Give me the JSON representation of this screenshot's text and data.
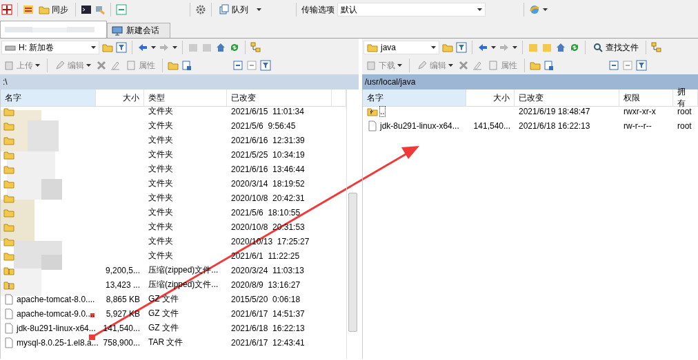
{
  "toolbar": {
    "sync": "同步",
    "queue": "队列",
    "transfer_label": "传输选项",
    "transfer_value": "默认"
  },
  "tabs": [
    {
      "kind": "blurred",
      "selected": true
    },
    {
      "kind": "new",
      "label": "新建会话",
      "selected": false
    }
  ],
  "left": {
    "drive": "H: 新加卷",
    "actions": [
      {
        "label": "上传",
        "disabled": true
      },
      {
        "label": "编辑",
        "disabled": true
      },
      {
        "label": "属性",
        "disabled": true
      }
    ],
    "path": ":\\",
    "columns": [
      "名字",
      "大小",
      "类型",
      "已改变"
    ],
    "rows": [
      {
        "kind": "folder",
        "type": "文件夹",
        "modified": "2021/6/15  11:01:34"
      },
      {
        "kind": "folder",
        "type": "文件夹",
        "modified": "2021/5/6  9:56:45"
      },
      {
        "kind": "folder",
        "type": "文件夹",
        "modified": "2021/6/16  12:31:39"
      },
      {
        "kind": "folder",
        "type": "文件夹",
        "modified": "2021/5/25  10:34:19"
      },
      {
        "kind": "folder",
        "type": "文件夹",
        "modified": "2021/6/16  13:46:44"
      },
      {
        "kind": "folder",
        "type": "文件夹",
        "modified": "2020/3/14  18:19:52"
      },
      {
        "kind": "folder",
        "type": "文件夹",
        "modified": "2020/10/8  20:42:31"
      },
      {
        "kind": "folder",
        "type": "文件夹",
        "modified": "2021/5/6  18:10:55"
      },
      {
        "kind": "folder",
        "type": "文件夹",
        "modified": "2020/10/8  20:31:53"
      },
      {
        "kind": "folder",
        "type": "文件夹",
        "modified": "2020/10/13  17:25:27"
      },
      {
        "kind": "folder",
        "type": "文件夹",
        "modified": "2021/6/1  11:22:25"
      },
      {
        "kind": "zip",
        "size": "9,200,5...",
        "type": "压缩(zipped)文件...",
        "modified": "2020/3/24  11:03:13"
      },
      {
        "kind": "zip",
        "size": "13,423 ...",
        "type": "压缩(zipped)文件...",
        "modified": "2020/8/9  13:16:27"
      },
      {
        "kind": "file",
        "name": "apache-tomcat-8.0....",
        "size": "8,865 KB",
        "type": "GZ 文件",
        "modified": "2015/5/20  0:06:18"
      },
      {
        "kind": "file",
        "name": "apache-tomcat-9.0....",
        "size": "5,927 KB",
        "type": "GZ 文件",
        "modified": "2021/6/17  14:51:37"
      },
      {
        "kind": "file",
        "name": "jdk-8u291-linux-x64...",
        "size": "141,540...",
        "type": "GZ 文件",
        "modified": "2021/6/18  16:22:13"
      },
      {
        "kind": "file",
        "name": "mysql-8.0.25-1.el8.a...",
        "size": "758,900...",
        "type": "TAR 文件",
        "modified": "2021/6/17  12:43:41"
      }
    ]
  },
  "right": {
    "folder": "java",
    "find": "查找文件",
    "actions": [
      {
        "label": "下载",
        "disabled": true
      },
      {
        "label": "编辑",
        "disabled": true
      },
      {
        "label": "属性",
        "disabled": true
      }
    ],
    "path": "/usr/local/java",
    "columns": [
      "名字",
      "大小",
      "已改变",
      "权限",
      "拥有"
    ],
    "rows": [
      {
        "kind": "parent",
        "name": "..",
        "modified": "2021/6/19 18:48:47",
        "rights": "rwxr-xr-x",
        "owner": "root"
      },
      {
        "kind": "file",
        "name": "jdk-8u291-linux-x64...",
        "size": "141,540...",
        "modified": "2021/6/18 16:22:13",
        "rights": "rw-r--r--",
        "owner": "root"
      }
    ]
  }
}
